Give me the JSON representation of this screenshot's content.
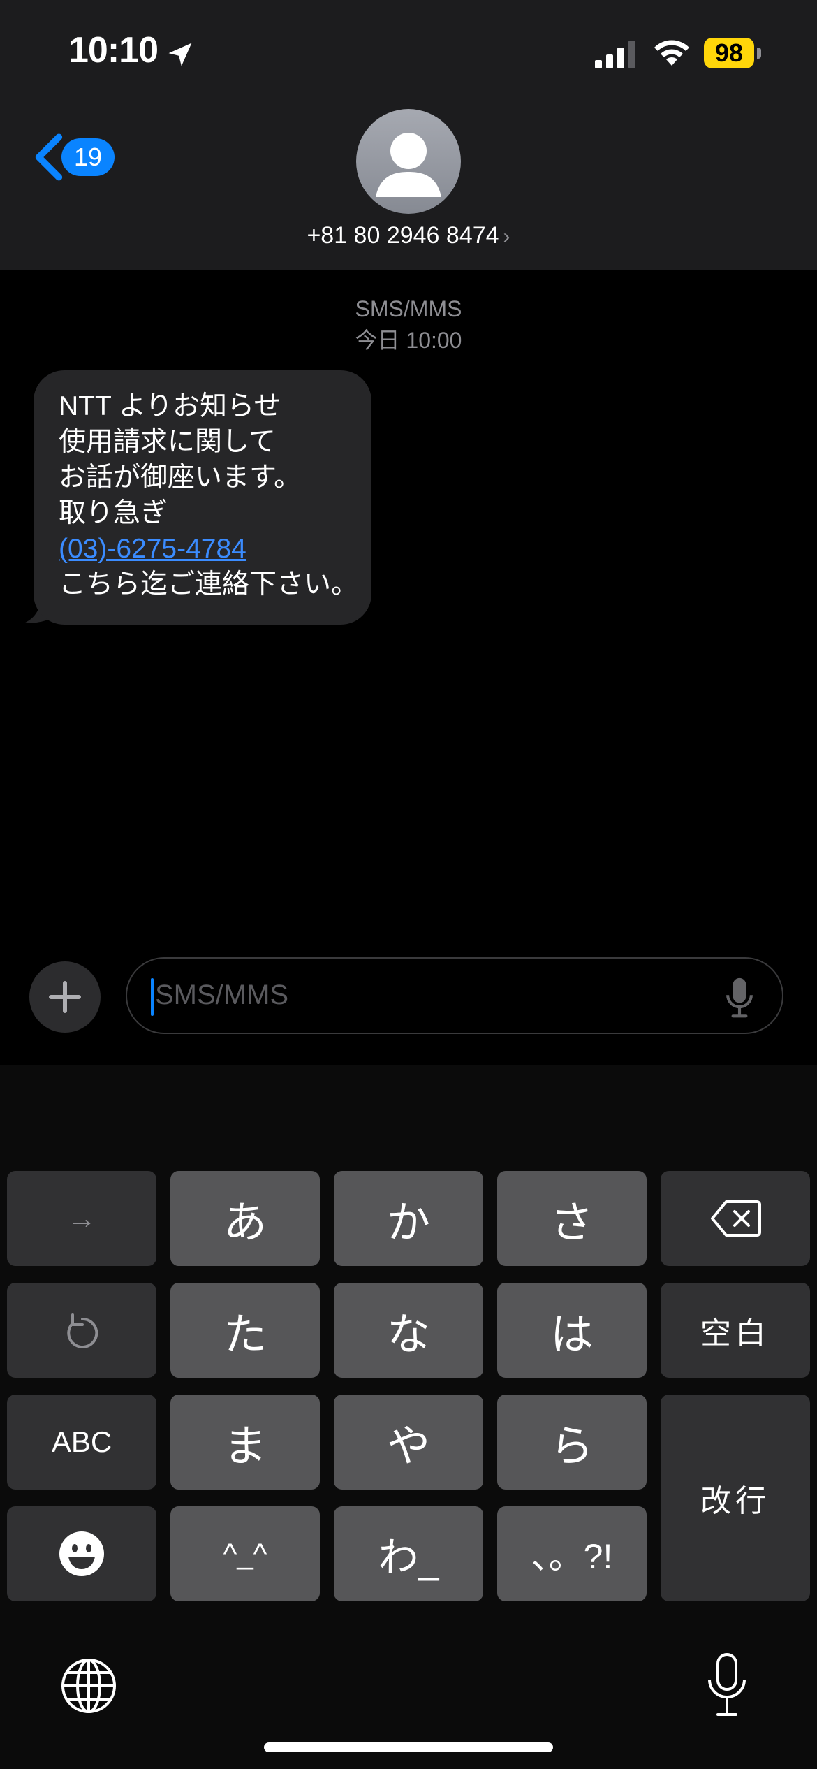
{
  "status_bar": {
    "time": "10:10",
    "battery_level": "98",
    "icons": [
      "location-arrow-icon",
      "cellular-signal-icon",
      "wifi-icon",
      "battery-icon"
    ]
  },
  "header": {
    "back_badge_count": "19",
    "contact_number": "+81 80 2946 8474",
    "contact_chevron": "›"
  },
  "thread": {
    "service_label": "SMS/MMS",
    "timestamp": "今日 10:00",
    "messages": [
      {
        "direction": "incoming",
        "lines": [
          "NTT よりお知らせ",
          "使用請求に関して",
          "お話が御座います。",
          "取り急ぎ",
          "(03)-6275-4784",
          "こちら迄ご連絡下さい。"
        ],
        "link": "(03)-6275-4784"
      }
    ]
  },
  "compose": {
    "placeholder": "SMS/MMS"
  },
  "keyboard": {
    "rows": [
      [
        "→",
        "あ",
        "か",
        "さ",
        "delete"
      ],
      [
        "undo",
        "た",
        "な",
        "は",
        "空白"
      ],
      [
        "ABC",
        "ま",
        "や",
        "ら",
        "改行"
      ],
      [
        "emoji",
        "^_^",
        "わ_",
        "、。?!"
      ]
    ],
    "keys": {
      "next": "→",
      "a": "あ",
      "ka": "か",
      "sa": "さ",
      "ta": "た",
      "na": "な",
      "ha": "は",
      "space": "空白",
      "abc": "ABC",
      "ma": "ま",
      "ya": "や",
      "ra": "ら",
      "return": "改行",
      "kaomoji": "^_^",
      "wa": "わ_",
      "punct": "、。?!"
    }
  },
  "colors": {
    "accent": "#0a84ff",
    "battery": "#ffd60a",
    "bubble_incoming": "#262628",
    "link": "#3b8cff"
  }
}
